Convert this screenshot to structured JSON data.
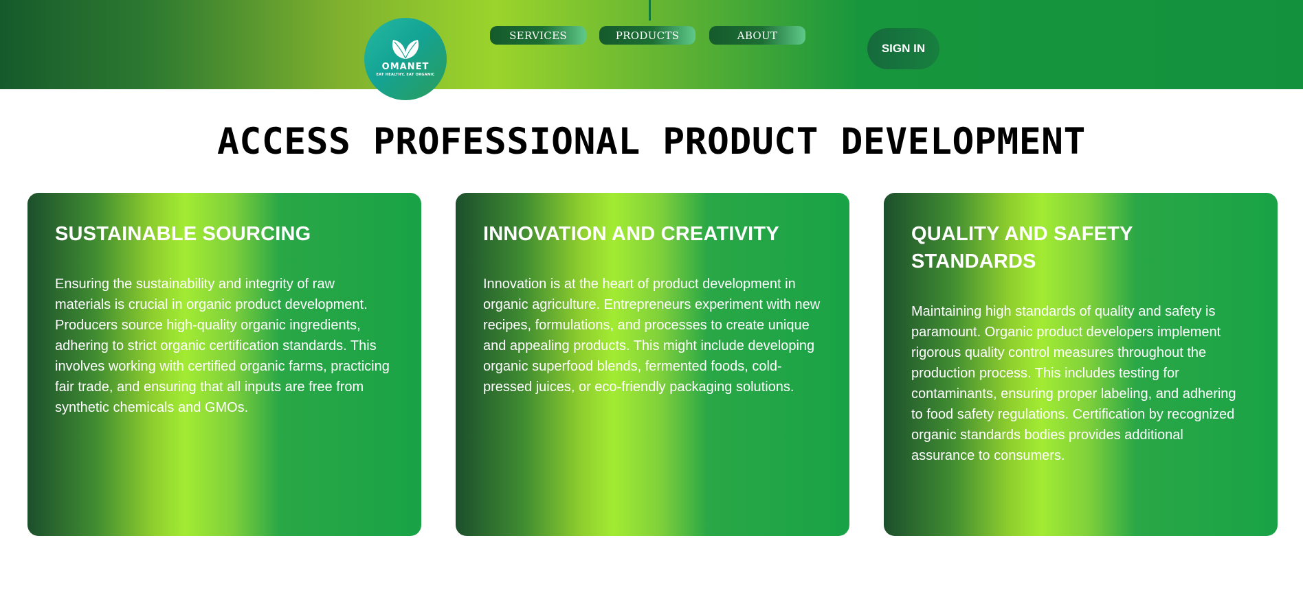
{
  "header": {
    "logo": {
      "name": "OMANET",
      "tagline": "EAT HEALTHY, EAT ORGANIC",
      "icon": "leaves-icon"
    },
    "nav": [
      {
        "label": "SERVICES"
      },
      {
        "label": "PRODUCTS"
      },
      {
        "label": "ABOUT"
      }
    ],
    "signin_label": "SIGN IN"
  },
  "main": {
    "title": "ACCESS PROFESSIONAL PRODUCT DEVELOPMENT",
    "cards": [
      {
        "title": "SUSTAINABLE SOURCING",
        "body": "Ensuring the sustainability and integrity of raw materials is crucial in organic product development. Producers source high-quality organic ingredients, adhering to strict organic certification standards. This involves working with certified organic farms, practicing fair trade, and ensuring that all inputs are free from synthetic chemicals and GMOs."
      },
      {
        "title": "INNOVATION AND CREATIVITY",
        "body": "Innovation is at the heart of product development in organic agriculture. Entrepreneurs experiment with new recipes, formulations, and processes to create unique and appealing products. This might include developing organic superfood blends, fermented foods, cold-pressed juices, or eco-friendly packaging solutions."
      },
      {
        "title": "QUALITY AND SAFETY STANDARDS",
        "body": "Maintaining high standards of quality and safety is paramount. Organic product developers implement rigorous quality control measures throughout the production process. This includes testing for contaminants, ensuring proper labeling, and adhering to food safety regulations. Certification by recognized organic standards bodies provides additional assurance to consumers."
      }
    ]
  },
  "colors": {
    "header_green": "#13913d",
    "accent_lime": "#a2eb33",
    "dark_green": "#155a2c",
    "text_light": "#ffffff"
  }
}
